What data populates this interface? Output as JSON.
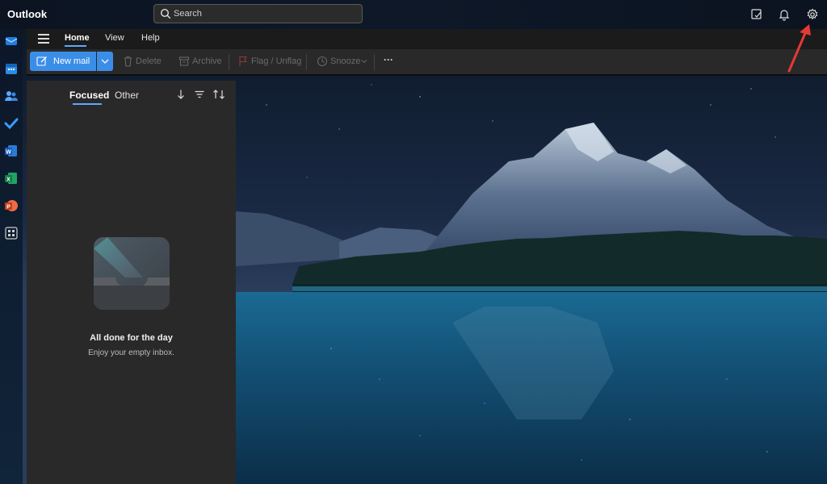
{
  "app": {
    "title": "Outlook"
  },
  "search": {
    "placeholder": "Search"
  },
  "top_icons": [
    "sticky-notes-icon",
    "bell-icon",
    "gear-icon"
  ],
  "rail_items": [
    "mail-icon",
    "calendar-icon",
    "people-icon",
    "todo-icon",
    "word-icon",
    "excel-icon",
    "powerpoint-icon",
    "apps-icon"
  ],
  "menu": {
    "tabs": [
      {
        "label": "Home",
        "active": true
      },
      {
        "label": "View",
        "active": false
      },
      {
        "label": "Help",
        "active": false
      }
    ]
  },
  "toolbar": {
    "new_mail": "New mail",
    "delete": "Delete",
    "archive": "Archive",
    "flag": "Flag / Unflag",
    "snooze": "Snooze",
    "more": "···"
  },
  "list": {
    "tabs": [
      {
        "label": "Focused",
        "active": true
      },
      {
        "label": "Other",
        "active": false
      }
    ],
    "empty_title": "All done for the day",
    "empty_subtitle": "Enjoy your empty inbox."
  },
  "colors": {
    "accent": "#3b8ee8",
    "underline": "#5fa8ff",
    "annotation_arrow": "#e53935"
  }
}
